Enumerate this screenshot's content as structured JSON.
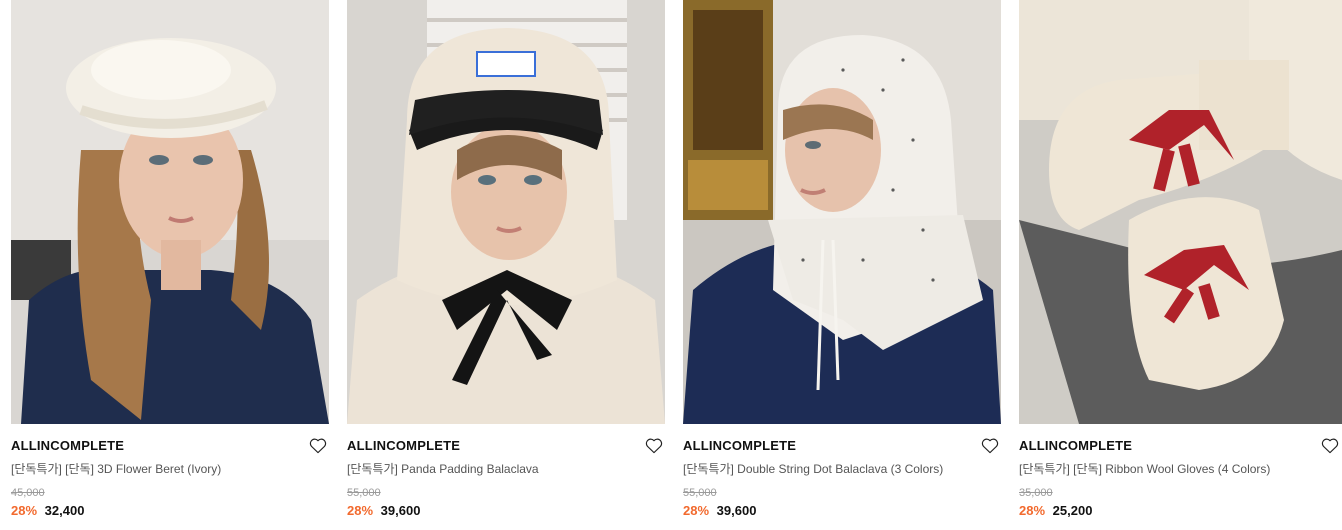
{
  "products": [
    {
      "brand": "ALLINCOMPLETE",
      "name": "[단독특가] [단독] 3D Flower Beret (Ivory)",
      "original_price": "45,000",
      "discount": "28%",
      "price": "32,400",
      "image_icon": "beret-photo"
    },
    {
      "brand": "ALLINCOMPLETE",
      "name": "[단독특가] Panda Padding Balaclava",
      "original_price": "55,000",
      "discount": "28%",
      "price": "39,600",
      "image_icon": "balaclava-photo"
    },
    {
      "brand": "ALLINCOMPLETE",
      "name": "[단독특가] Double String Dot Balaclava (3 Colors)",
      "original_price": "55,000",
      "discount": "28%",
      "price": "39,600",
      "image_icon": "knit-hood-photo"
    },
    {
      "brand": "ALLINCOMPLETE",
      "name": "[단독특가] [단독] Ribbon Wool Gloves (4 Colors)",
      "original_price": "35,000",
      "discount": "28%",
      "price": "25,200",
      "image_icon": "gloves-photo"
    }
  ],
  "colors": {
    "discount": "#f26a2e",
    "strikethrough": "#9a9a9a",
    "brand": "#111111"
  },
  "icons": {
    "wishlist": "heart-outline-icon"
  }
}
